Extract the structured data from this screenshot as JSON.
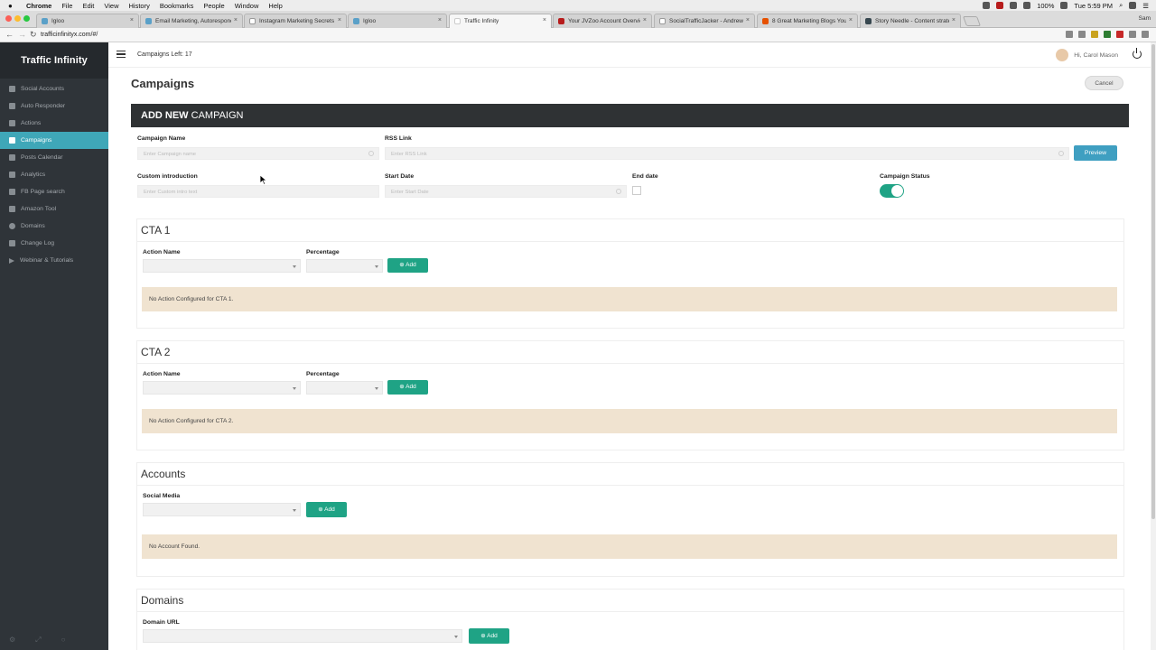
{
  "menubar": {
    "app": "Chrome",
    "items": [
      "File",
      "Edit",
      "View",
      "History",
      "Bookmarks",
      "People",
      "Window",
      "Help"
    ],
    "battery": "100%",
    "clock": "Tue 5:59 PM"
  },
  "tabs": [
    {
      "label": "Igloo"
    },
    {
      "label": "Email Marketing, Autorespond"
    },
    {
      "label": "Instagram Marketing Secrets"
    },
    {
      "label": "Igloo"
    },
    {
      "label": "Traffic Infinity"
    },
    {
      "label": "Your JVZoo Account Overview"
    },
    {
      "label": "SocialTrafficJacker - Andrew"
    },
    {
      "label": "8 Great Marketing Blogs You"
    },
    {
      "label": "Story Needle - Content strate"
    }
  ],
  "browser_user": "Sam",
  "url": "trafficinfinityx.com/#/",
  "sidebar": {
    "logo": "Traffic Infinity",
    "items": [
      {
        "label": "Social Accounts"
      },
      {
        "label": "Auto Responder"
      },
      {
        "label": "Actions"
      },
      {
        "label": "Campaigns"
      },
      {
        "label": "Posts Calendar"
      },
      {
        "label": "Analytics"
      },
      {
        "label": "FB Page search"
      },
      {
        "label": "Amazon Tool"
      },
      {
        "label": "Domains"
      },
      {
        "label": "Change Log"
      },
      {
        "label": "Webinar & Tutorials"
      }
    ],
    "active": "Campaigns"
  },
  "topbar": {
    "campaigns_left": "Campaigns Left: 17",
    "greeting": "Hi, Carol Mason"
  },
  "page": {
    "title": "Campaigns",
    "cancel": "Cancel",
    "panel_bold": "ADD NEW",
    "panel_rest": " CAMPAIGN"
  },
  "form": {
    "campaign_name_label": "Campaign Name",
    "campaign_name_placeholder": "Enter Campaign name",
    "rss_label": "RSS Link",
    "rss_placeholder": "Enter RSS Link",
    "preview": "Preview",
    "intro_label": "Custom introduction",
    "intro_placeholder": "Enter Custom intro text",
    "start_label": "Start Date",
    "start_placeholder": "Enter Start Date",
    "end_label": "End date",
    "status_label": "Campaign Status",
    "status_on": true
  },
  "cta1": {
    "title": "CTA 1",
    "action_label": "Action Name",
    "percentage_label": "Percentage",
    "add": "⊕ Add",
    "notice": "No Action Configured for CTA 1."
  },
  "cta2": {
    "title": "CTA 2",
    "action_label": "Action Name",
    "percentage_label": "Percentage",
    "add": "⊕ Add",
    "notice": "No Action Configured for CTA 2."
  },
  "accounts": {
    "title": "Accounts",
    "social_label": "Social Media",
    "add": "⊕ Add",
    "notice": "No Account Found."
  },
  "domains": {
    "title": "Domains",
    "url_label": "Domain URL",
    "add": "⊕ Add"
  }
}
